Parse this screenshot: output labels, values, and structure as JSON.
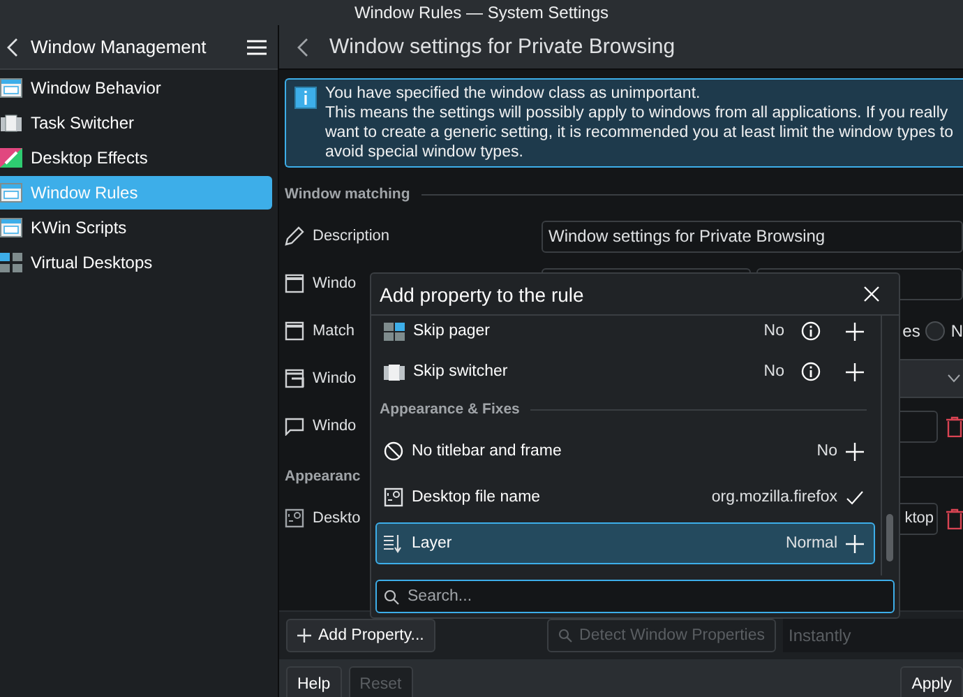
{
  "window": {
    "title": "Window Rules — System Settings"
  },
  "sidebar": {
    "title": "Window Management",
    "items": [
      {
        "label": "Window Behavior",
        "selected": false
      },
      {
        "label": "Task Switcher",
        "selected": false
      },
      {
        "label": "Desktop Effects",
        "selected": false
      },
      {
        "label": "Window Rules",
        "selected": true
      },
      {
        "label": "KWin Scripts",
        "selected": false
      },
      {
        "label": "Virtual Desktops",
        "selected": false
      }
    ]
  },
  "page": {
    "title": "Window settings for Private Browsing"
  },
  "info_message": {
    "lines": [
      "You have specified the window class as unimportant.",
      "This means the settings will possibly apply to windows from all applications. If you really want to create a generic setting, it is recommended you at least limit the window types to avoid special window types."
    ]
  },
  "sections": [
    {
      "title": "Window matching",
      "rows": [
        {
          "kind": "text",
          "label": "Description",
          "value": "Window settings for Private Browsing"
        },
        {
          "kind": "fields",
          "label": "Windo"
        },
        {
          "kind": "radio",
          "label": "Match",
          "option_a": "es",
          "option_b": "N",
          "checked": false
        },
        {
          "kind": "combo",
          "label": "Windo"
        },
        {
          "kind": "delete",
          "label": "Windo",
          "value": ""
        }
      ]
    },
    {
      "title": "Appearanc",
      "rows": [
        {
          "kind": "delete",
          "label": "Deskto",
          "value": "ktop"
        }
      ]
    }
  ],
  "bottom_bar": {
    "add_property": "Add Property...",
    "detect": {
      "label": "Detect Window Properties",
      "disabled": true
    },
    "delay": "Instantly"
  },
  "footer": {
    "buttons": [
      {
        "label": "Help",
        "disabled": false
      },
      {
        "label": "Reset",
        "disabled": true
      },
      {
        "label": "Apply",
        "disabled": false
      }
    ]
  },
  "dialog": {
    "title": "Add property to the rule",
    "items": [
      {
        "kind": "property",
        "label": "Skip pager",
        "value": "No",
        "info": true,
        "added": false,
        "selected": false
      },
      {
        "kind": "property",
        "label": "Skip switcher",
        "value": "No",
        "info": true,
        "added": false,
        "selected": false
      },
      {
        "kind": "section",
        "label": "Appearance & Fixes"
      },
      {
        "kind": "property",
        "label": "No titlebar and frame",
        "value": "No",
        "info": false,
        "added": false,
        "selected": false
      },
      {
        "kind": "property",
        "label": "Desktop file name",
        "value": "org.mozilla.firefox",
        "info": false,
        "added": true,
        "selected": false
      },
      {
        "kind": "property",
        "label": "Layer",
        "value": "Normal",
        "info": false,
        "added": false,
        "selected": true
      }
    ],
    "search": {
      "placeholder": "Search..."
    }
  }
}
